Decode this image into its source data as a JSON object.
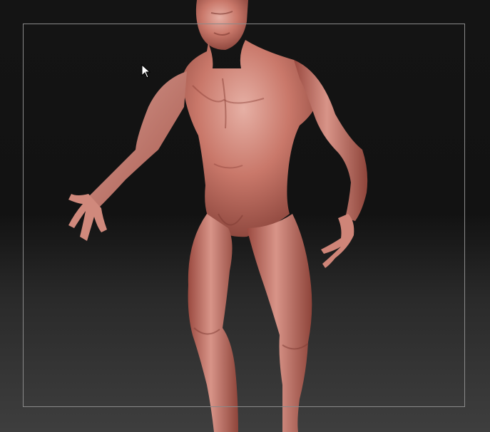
{
  "app": {
    "view": "3d-viewport"
  },
  "colors": {
    "background_top": "#121212",
    "background_bottom": "#3e3e3e",
    "frame": "#8a8a8a",
    "skin_light": "#e8b3a8",
    "skin_mid": "#c9786a",
    "skin_dark": "#8a3f36"
  },
  "icons": {
    "cursor": "arrow-pointer-icon"
  }
}
